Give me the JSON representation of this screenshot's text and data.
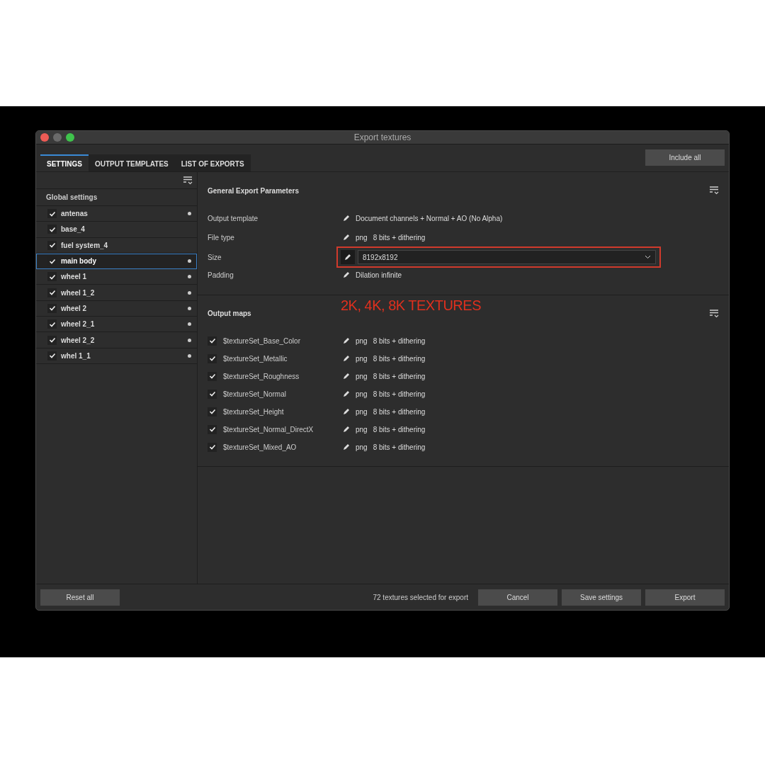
{
  "window": {
    "title": "Export textures"
  },
  "tabs": [
    {
      "label": "SETTINGS",
      "selected": true
    },
    {
      "label": "OUTPUT TEMPLATES",
      "selected": false
    },
    {
      "label": "LIST OF EXPORTS",
      "selected": false
    }
  ],
  "include_all_button": "Include all",
  "sidebar": {
    "header": "Global settings",
    "items": [
      {
        "name": "antenas",
        "checked": true,
        "selected": false,
        "modified": true
      },
      {
        "name": "base_4",
        "checked": true,
        "selected": false,
        "modified": false
      },
      {
        "name": "fuel system_4",
        "checked": true,
        "selected": false,
        "modified": false
      },
      {
        "name": "main body",
        "checked": true,
        "selected": true,
        "modified": true
      },
      {
        "name": "wheel 1",
        "checked": true,
        "selected": false,
        "modified": true
      },
      {
        "name": "wheel 1_2",
        "checked": true,
        "selected": false,
        "modified": true
      },
      {
        "name": "wheel 2",
        "checked": true,
        "selected": false,
        "modified": true
      },
      {
        "name": "wheel 2_1",
        "checked": true,
        "selected": false,
        "modified": true
      },
      {
        "name": "wheel 2_2",
        "checked": true,
        "selected": false,
        "modified": true
      },
      {
        "name": "whel 1_1",
        "checked": true,
        "selected": false,
        "modified": true
      }
    ]
  },
  "general": {
    "title": "General Export Parameters",
    "rows": [
      {
        "kind": "text",
        "label": "Output template",
        "values": [
          "Document channels + Normal + AO (No Alpha)"
        ]
      },
      {
        "kind": "text",
        "label": "File type",
        "values": [
          "png",
          "8 bits + dithering"
        ]
      },
      {
        "kind": "dropdown",
        "label": "Size",
        "values": [
          "8192x8192"
        ]
      },
      {
        "kind": "text",
        "label": "Padding",
        "values": [
          "Dilation infinite"
        ]
      }
    ]
  },
  "annotation": "2K, 4K, 8K TEXTURES",
  "output_maps": {
    "title": "Output maps",
    "items": [
      {
        "name": "$textureSet_Base_Color",
        "checked": true,
        "format": "png",
        "depth": "8 bits + dithering"
      },
      {
        "name": "$textureSet_Metallic",
        "checked": true,
        "format": "png",
        "depth": "8 bits + dithering"
      },
      {
        "name": "$textureSet_Roughness",
        "checked": true,
        "format": "png",
        "depth": "8 bits + dithering"
      },
      {
        "name": "$textureSet_Normal",
        "checked": true,
        "format": "png",
        "depth": "8 bits + dithering"
      },
      {
        "name": "$textureSet_Height",
        "checked": true,
        "format": "png",
        "depth": "8 bits + dithering"
      },
      {
        "name": "$textureSet_Normal_DirectX",
        "checked": true,
        "format": "png",
        "depth": "8 bits + dithering"
      },
      {
        "name": "$textureSet_Mixed_AO",
        "checked": true,
        "format": "png",
        "depth": "8 bits + dithering"
      }
    ]
  },
  "footer": {
    "reset_button": "Reset all",
    "status": "72 textures selected for export",
    "buttons": [
      "Cancel",
      "Save settings",
      "Export"
    ]
  }
}
